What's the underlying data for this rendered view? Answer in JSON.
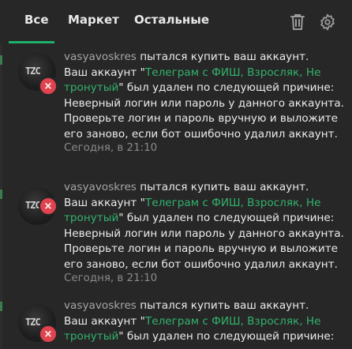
{
  "tabs": {
    "all": "Все",
    "market": "Маркет",
    "other": "Остальные"
  },
  "header": {
    "trash_icon": "trash-icon",
    "gear_icon": "gear-icon"
  },
  "colors": {
    "accent": "#1fb06a",
    "link": "#32b26d",
    "error": "#e0434d",
    "background": "#272727"
  },
  "notifications": [
    {
      "avatar_text": "TZC",
      "user": "vasyavoskres",
      "line1": " пытался купить ваш аккаунт.",
      "pre": "Ваш аккаунт \"",
      "account": "Телеграм с ФИШ, Взросляк, Не тронутый",
      "post": "\" был удален по следующей причине: Неверный логин или пароль у данного аккаунта. Проверьте логин и пароль вручную и выложите его заново, если бот ошибочно удалил аккаунт.",
      "time": "Сегодня, в 21:10"
    },
    {
      "avatar_text": "TZC",
      "user": "vasyavoskres",
      "line1": " пытался купить ваш аккаунт.",
      "pre": "Ваш аккаунт \"",
      "account": "Телеграм с ФИШ, Взросляк, Не тронутый",
      "post": "\" был удален по следующей причине: Неверный логин или пароль у данного аккаунта. Проверьте логин и пароль вручную и выложите его заново, если бот ошибочно удалил аккаунт.",
      "time": "Сегодня, в 21:10"
    },
    {
      "avatar_text": "TZC",
      "user": "vasyavoskres",
      "line1": " пытался купить ваш аккаунт.",
      "pre": "Ваш аккаунт \"",
      "account": "Телеграм с ФИШ, Взросляк, Не тронутый",
      "post": "\" был удален по следующей причине:",
      "time": ""
    }
  ]
}
